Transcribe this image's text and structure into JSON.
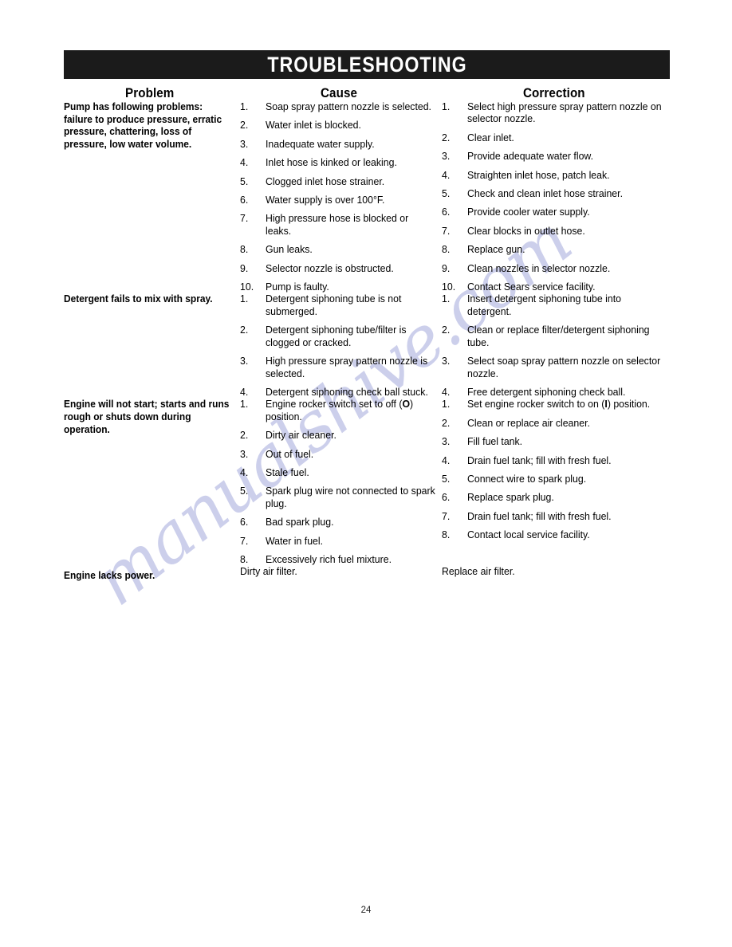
{
  "document": {
    "banner_title": "TROUBLESHOOTING",
    "page_number": "24",
    "watermark_text": "manualshive.com",
    "watermark_color": "#b9bde4",
    "banner_color": "#1b1b1b",
    "rule_color": "#111111"
  },
  "table": {
    "headers": {
      "problem": "Problem",
      "cause": "Cause",
      "correction": "Correction"
    },
    "rows": [
      {
        "problem": "Pump has following problems: failure to produce pressure, erratic pressure, chattering, loss of pressure, low water volume.",
        "causes": [
          "Soap spray pattern nozzle is selected.",
          "Water inlet is blocked.",
          "Inadequate water supply.",
          "Inlet hose is kinked or leaking.",
          "Clogged inlet hose strainer.",
          "Water supply is over 100°F.",
          "High pressure hose is blocked or leaks.",
          "Gun leaks.",
          "Selector nozzle is obstructed.",
          "Pump is faulty."
        ],
        "corrections": [
          "Select high pressure spray pattern nozzle on selector nozzle.",
          "Clear inlet.",
          "Provide adequate water flow.",
          "Straighten inlet hose, patch leak.",
          "Check and clean inlet hose strainer.",
          "Provide cooler water supply.",
          "Clear blocks in outlet hose.",
          "Replace gun.",
          "Clean nozzles in selector nozzle.",
          "Contact Sears service facility."
        ],
        "correction_gap_before_index": 7
      },
      {
        "problem": "Detergent fails to mix with spray.",
        "causes": [
          "Detergent siphoning tube is not submerged.",
          "Detergent siphoning tube/filter is clogged or cracked.",
          "High pressure spray pattern nozzle is selected.",
          "Detergent siphoning check ball stuck."
        ],
        "corrections": [
          "Insert detergent siphoning tube into detergent.",
          "Clean or replace filter/detergent siphoning tube.",
          "Select soap spray pattern nozzle on selector nozzle.",
          "Free detergent siphoning check ball."
        ],
        "correction_gap_before_index": -1
      },
      {
        "problem": "Engine will not start; starts and runs rough or shuts down during operation.",
        "causes": [
          "Engine rocker switch set to off (<b>O</b>) position.",
          "Dirty air cleaner.",
          "Out of fuel.",
          "Stale fuel.",
          "Spark plug wire not connected to spark plug.",
          "Bad spark plug.",
          "Water in fuel.",
          "Excessively rich fuel mixture."
        ],
        "corrections": [
          "Set engine rocker switch to on (<b>I</b>) position.",
          "Clean or replace air cleaner.",
          "Fill fuel tank.",
          "Drain fuel tank; fill with fresh fuel.",
          "Connect wire to spark plug.",
          "Replace spark plug.",
          "Drain fuel tank; fill with fresh fuel.",
          "Contact local service facility."
        ],
        "correction_gap_before_index": 5
      }
    ],
    "last_row": {
      "problem": "Engine lacks power.",
      "cause": "Dirty air filter.",
      "correction": "Replace air filter."
    }
  }
}
